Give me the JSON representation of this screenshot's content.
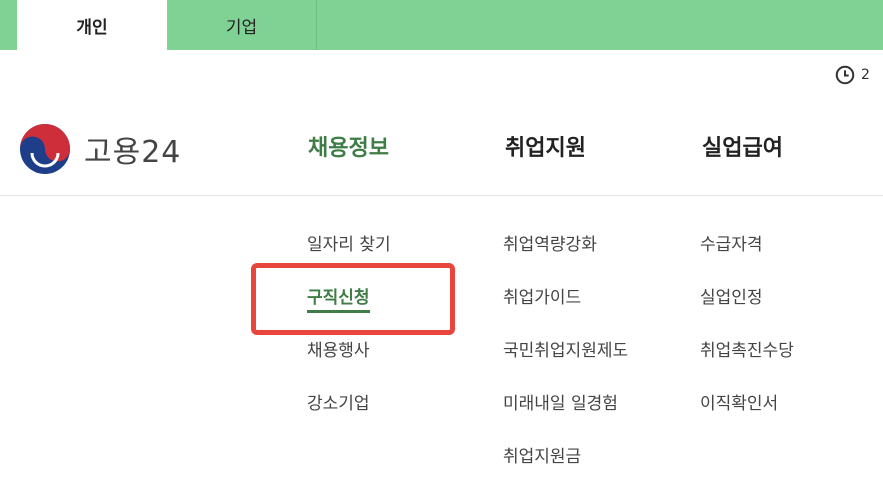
{
  "top_tabs": {
    "personal": "개인",
    "company": "기업"
  },
  "clock": {
    "icon": "clock-icon",
    "text": "2"
  },
  "logo": {
    "text": "고용24"
  },
  "gnb": {
    "recruit": "채용정보",
    "employment_support": "취업지원",
    "unemployment_benefit": "실업급여"
  },
  "submenu": {
    "recruit": [
      "일자리 찾기",
      "구직신청",
      "채용행사",
      "강소기업"
    ],
    "employment_support": [
      "취업역량강화",
      "취업가이드",
      "국민취업지원제도",
      "미래내일 일경험",
      "취업지원금"
    ],
    "unemployment_benefit": [
      "수급자격",
      "실업인정",
      "취업촉진수당",
      "이직확인서"
    ]
  },
  "colors": {
    "top_bar": "#7fd194",
    "active_green": "#3e7d45",
    "highlight_red": "#e8463c"
  }
}
